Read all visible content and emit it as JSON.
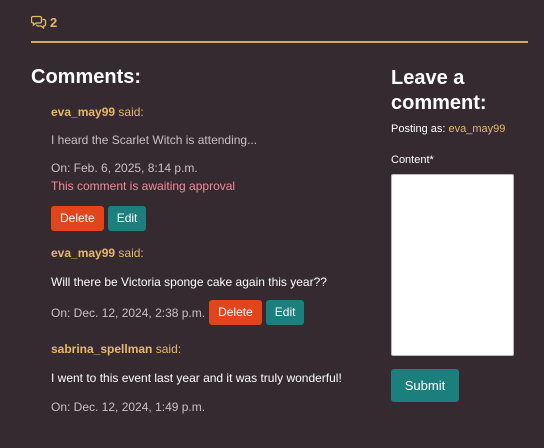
{
  "header": {
    "comment_count": "2",
    "icon": "comments-icon"
  },
  "comments_section": {
    "title": "Comments:",
    "comments": [
      {
        "author": "eva_may99",
        "said": " said:",
        "text": "I heard the Scarlet Witch is attending...",
        "date": "On: Feb. 6, 2025, 8:14 p.m.",
        "status": "This comment is awaiting approval",
        "delete_label": "Delete",
        "edit_label": "Edit"
      },
      {
        "author": "eva_may99",
        "said": " said:",
        "text": "Will there be Victoria sponge cake again this year??",
        "date": "On: Dec. 12, 2024, 2:38 p.m.",
        "delete_label": "Delete",
        "edit_label": "Edit"
      },
      {
        "author": "sabrina_spellman",
        "said": " said:",
        "text": "I went to this event last year and it was truly wonderful!",
        "date": "On: Dec. 12, 2024, 1:49 p.m."
      }
    ]
  },
  "comment_form": {
    "title_line1": "Leave a",
    "title_line2": "comment:",
    "posting_as_label": "Posting as: ",
    "posting_as_user": "eva_may99",
    "content_label": "Content*",
    "content_value": "",
    "submit_label": "Submit"
  },
  "colors": {
    "background": "#342a2f",
    "accent": "#e8b86a",
    "delete": "#e0451c",
    "edit": "#1a7f7d"
  }
}
